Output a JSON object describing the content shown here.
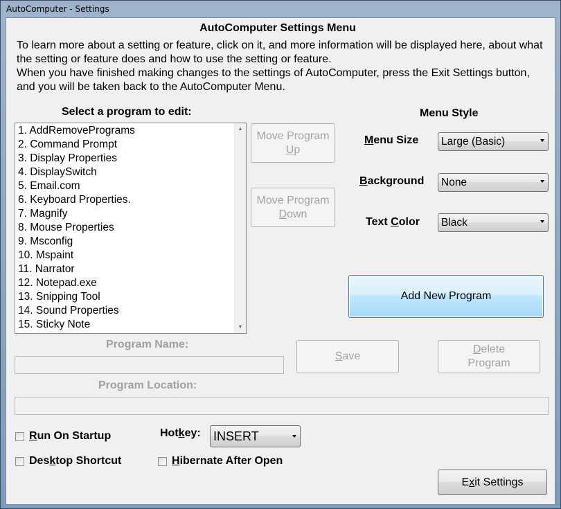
{
  "window": {
    "title": "AutoComputer - Settings"
  },
  "header": {
    "title": "AutoComputer Settings Menu",
    "info_line1": "To learn more about a setting or feature, click on it, and more information will be displayed here, about what",
    "info_line2": "the setting or feature does and how to use the setting or feature.",
    "info_line3": "When you have finished making changes to the settings of AutoComputer, press the Exit Settings button,",
    "info_line4": "and you will be taken back to the AutoComputer Menu."
  },
  "programs": {
    "label": "Select a program to edit:",
    "items": [
      "1. AddRemovePrograms",
      "2. Command Prompt",
      "3. Display Properties",
      "4. DisplaySwitch",
      "5. Email.com",
      "6. Keyboard Properties.",
      "7. Magnify",
      "8. Mouse Properties",
      "9. Msconfig",
      "10. Mspaint",
      "11. Narrator",
      "12. Notepad.exe",
      "13. Snipping Tool",
      "14. Sound Properties",
      "15. Sticky Note"
    ]
  },
  "move_up": {
    "line1": "Move Program",
    "line2_mnemonic": "U",
    "line2_rest": "p"
  },
  "move_down": {
    "line1": "Move Program",
    "line2_mnemonic": "D",
    "line2_rest": "own"
  },
  "menu_style": {
    "heading": "Menu Style",
    "size_label_mnemonic": "M",
    "size_label_rest": "enu Size",
    "size_value": "Large (Basic)",
    "background_label_mnemonic": "B",
    "background_label_rest": "ackground",
    "background_value": "None",
    "text_color_label_prefix": "Text ",
    "text_color_label_mnemonic": "C",
    "text_color_label_rest": "olor",
    "text_color_value": "Black"
  },
  "add_new_program": "Add New Program",
  "program_name": {
    "label": "Program Name:",
    "value": ""
  },
  "program_location": {
    "label": "Program Location:",
    "value": ""
  },
  "save": {
    "mnemonic": "S",
    "rest": "ave"
  },
  "delete": {
    "line1_mnemonic": "D",
    "line1_rest": "elete",
    "line2": "Program"
  },
  "run_on_startup": {
    "mnemonic": "R",
    "rest": "un On Startup"
  },
  "desktop_shortcut": {
    "prefix": "Des",
    "mnemonic": "k",
    "rest": "top Shortcut"
  },
  "hotkey": {
    "prefix": "Hot",
    "mnemonic": "k",
    "rest": "ey:",
    "value": "INSERT"
  },
  "hibernate": {
    "mnemonic": "H",
    "rest": "ibernate After Open"
  },
  "exit": {
    "prefix": "E",
    "mnemonic": "x",
    "rest": "it Settings"
  }
}
